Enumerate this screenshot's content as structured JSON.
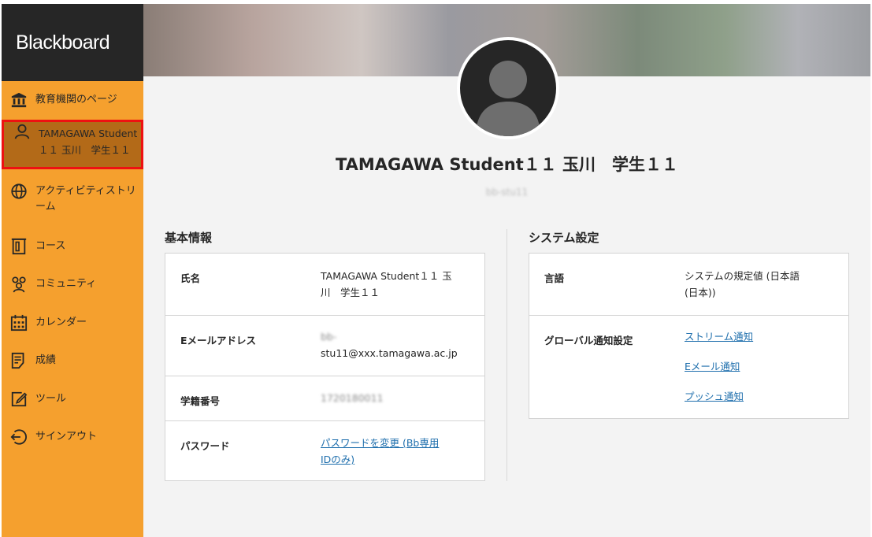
{
  "brand": "Blackboard",
  "nav": {
    "institution": "教育機関のページ",
    "profile_line1": "TAMAGAWA Student",
    "profile_line2": "１１ 玉川　学生１１",
    "activity_line1": "アクティビティストリ",
    "activity_line2": "ーム",
    "courses": "コース",
    "community": "コミュニティ",
    "calendar": "カレンダー",
    "grades": "成績",
    "tools": "ツール",
    "signout": "サインアウト"
  },
  "profile": {
    "name": "TAMAGAWA Student１１ 玉川　学生１１",
    "username": "bb-stu11"
  },
  "basic_info": {
    "title": "基本情報",
    "name_label": "氏名",
    "name_line1": "TAMAGAWA Student１１ 玉",
    "name_line2": "川　学生１１",
    "email_label": "Eメールアドレス",
    "email_line1": "bb-",
    "email_line2": "stu11@xxx.tamagawa.ac.jp",
    "student_no_label": "学籍番号",
    "student_no": "1720180011",
    "password_label": "パスワード",
    "password_link_line1": "パスワードを変更 (Bb専用",
    "password_link_line2": "IDのみ)"
  },
  "system_settings": {
    "title": "システム設定",
    "language_label": "言語",
    "language_line1": "システムの規定値 (日本語",
    "language_line2": "(日本))",
    "notify_label": "グローバル通知設定",
    "stream_notify": "ストリーム通知",
    "email_notify": "Eメール通知",
    "push_notify": "プッシュ通知"
  }
}
